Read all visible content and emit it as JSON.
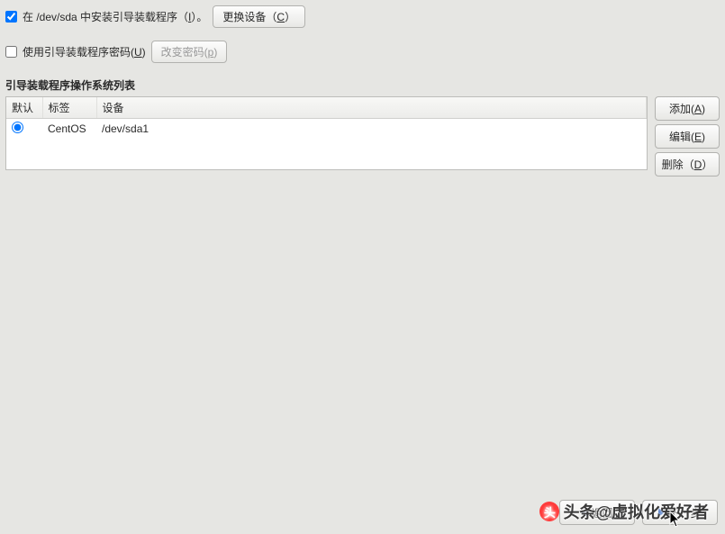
{
  "options": {
    "install_bootloader": {
      "checked": true,
      "label_before": "在 /dev/sda 中安装引导装载程序（",
      "mnemonic": "I",
      "label_after": "）。"
    },
    "change_device": {
      "label_before": "更换设备（",
      "mnemonic": "C",
      "label_after": "）"
    },
    "use_password": {
      "checked": false,
      "label_before": "使用引导装载程序密码(",
      "mnemonic": "U",
      "label_after": ")"
    },
    "change_password": {
      "label_before": "改变密码(",
      "mnemonic": "p",
      "label_after": ")"
    }
  },
  "list": {
    "title": "引导装载程序操作系统列表",
    "headers": {
      "default": "默认",
      "label": "标签",
      "device": "设备"
    },
    "rows": [
      {
        "selected": true,
        "label": "CentOS",
        "device": "/dev/sda1"
      }
    ]
  },
  "side": {
    "add": {
      "pre": "添加(",
      "mn": "A",
      "post": ")"
    },
    "edit": {
      "pre": "编辑(",
      "mn": "E",
      "post": ")"
    },
    "delete": {
      "pre": "删除（",
      "mn": "D",
      "post": "）"
    }
  },
  "nav": {
    "back_label": "返回",
    "next_label": "下一步"
  },
  "watermark": {
    "prefix": "头条",
    "handle": "@虚拟化爱好者"
  }
}
